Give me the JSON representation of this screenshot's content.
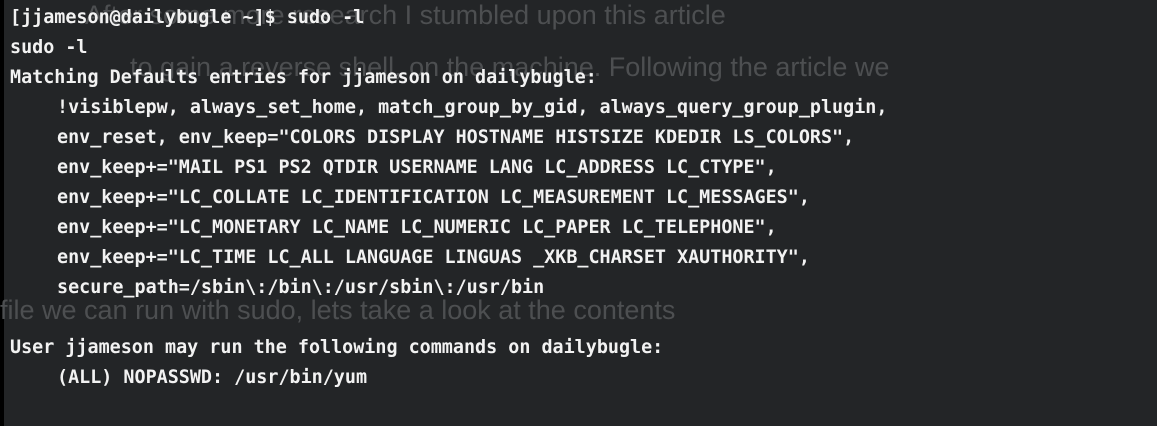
{
  "terminal": {
    "prompt": "[jjameson@dailybugle ~]$ sudo -l",
    "echo": "sudo -l",
    "defaults_header": "Matching Defaults entries for jjameson on dailybugle:",
    "defaults_lines": [
      "!visiblepw, always_set_home, match_group_by_gid, always_query_group_plugin,",
      "env_reset, env_keep=\"COLORS DISPLAY HOSTNAME HISTSIZE KDEDIR LS_COLORS\",",
      "env_keep+=\"MAIL PS1 PS2 QTDIR USERNAME LANG LC_ADDRESS LC_CTYPE\",",
      "env_keep+=\"LC_COLLATE LC_IDENTIFICATION LC_MEASUREMENT LC_MESSAGES\",",
      "env_keep+=\"LC_MONETARY LC_NAME LC_NUMERIC LC_PAPER LC_TELEPHONE\",",
      "env_keep+=\"LC_TIME LC_ALL LANGUAGE LINGUAS _XKB_CHARSET XAUTHORITY\",",
      "secure_path=/sbin\\:/bin\\:/usr/sbin\\:/usr/bin"
    ],
    "commands_header": "User jjameson may run the following commands on dailybugle:",
    "commands_line": "(ALL) NOPASSWD: /usr/bin/yum"
  },
  "background_text": {
    "line1": "After some more research I stumbled upon this article",
    "line2": "to gain a reverse shell, on the machine. Following the article we",
    "line3": "file we can run with sudo, lets take a look at the contents"
  }
}
